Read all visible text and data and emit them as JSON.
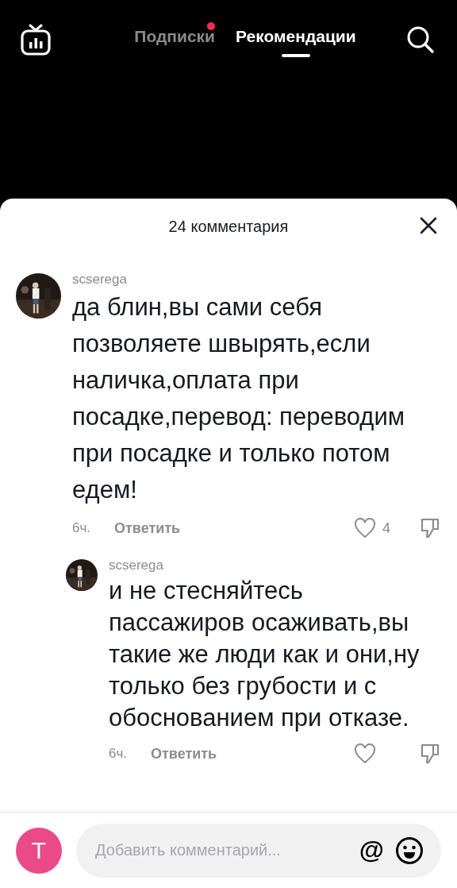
{
  "top_bar": {
    "tabs": [
      {
        "label": "Подписки",
        "selected": false,
        "dot": true
      },
      {
        "label": "Рекомендации",
        "selected": true,
        "dot": false
      }
    ]
  },
  "comments_sheet": {
    "title": "24 комментария",
    "comments": [
      {
        "kind": "top",
        "username": "scserega",
        "text": "да блин,вы сами себя позволяете швырять,если наличка,оплата при посадке,перевод: переводим при посадке и только потом едем!",
        "time": "6ч.",
        "reply": "Ответить",
        "liked": false,
        "likes": "4"
      },
      {
        "kind": "reply",
        "username": "scserega",
        "text": "и не стесняйтесь пассажиров осаживать,вы такие же люди как и они,ну только без грубости и с обоснованием при отказе.",
        "time": "6ч.",
        "reply": "Ответить",
        "liked": false
      }
    ]
  },
  "composer": {
    "avatar_letter": "T",
    "placeholder": "Добавить комментарий...",
    "mention": "@"
  }
}
